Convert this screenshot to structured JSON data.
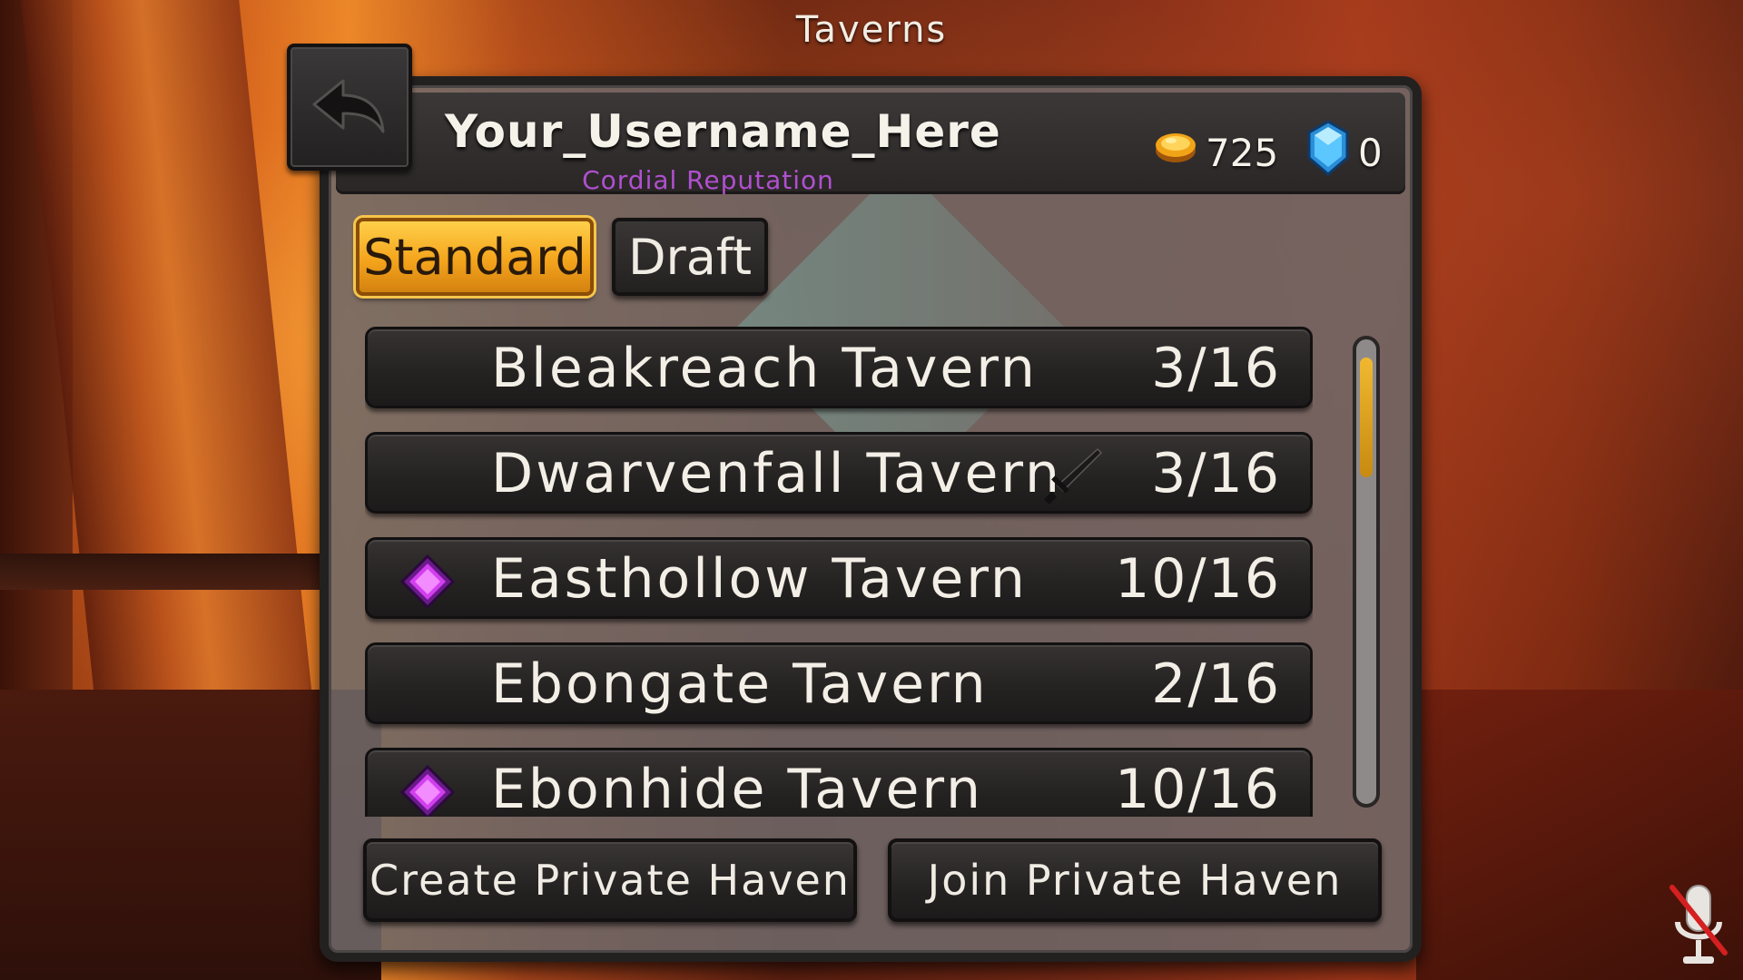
{
  "screen_title": "Taverns",
  "header": {
    "username": "Your_Username_Here",
    "reputation": "Cordial Reputation",
    "gold_amount": "725",
    "gem_amount": "0",
    "icons": {
      "gold": "gold-coin-icon",
      "gem": "blue-gem-icon"
    }
  },
  "back_button": {
    "icon": "back-arrow-icon"
  },
  "tabs": [
    {
      "label": "Standard",
      "active": true
    },
    {
      "label": "Draft",
      "active": false
    }
  ],
  "taverns": [
    {
      "name": "Bleakreach Tavern",
      "count": "3/16",
      "badge": null
    },
    {
      "name": "Dwarvenfall Tavern",
      "count": "3/16",
      "badge": "sword-icon"
    },
    {
      "name": "Easthollow Tavern",
      "count": "10/16",
      "badge": "purple-gem-icon"
    },
    {
      "name": "Ebongate Tavern",
      "count": "2/16",
      "badge": null
    },
    {
      "name": "Ebonhide Tavern",
      "count": "10/16",
      "badge": "purple-gem-icon"
    }
  ],
  "scroll": {
    "position_fraction": 0.0,
    "visible_fraction": 0.28
  },
  "buttons": {
    "create": "Create Private Haven",
    "join": "Join Private Haven"
  },
  "mic": {
    "icon": "microphone-muted-icon",
    "muted": true
  },
  "colors": {
    "accent_gold": "#f4a51c",
    "reputation_purple": "#b050d0",
    "panel_dark": "#232020"
  }
}
